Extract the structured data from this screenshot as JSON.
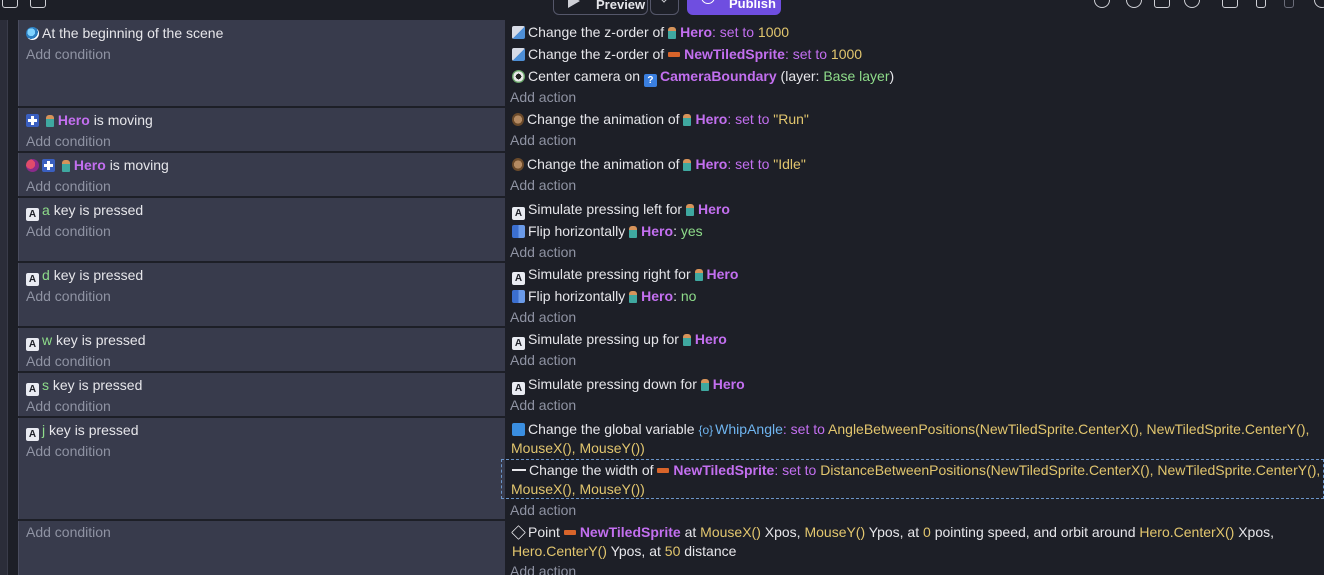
{
  "toolbar": {
    "preview_label": "Preview",
    "publish_label": "Publish"
  },
  "events": [
    {
      "conditions": [
        {
          "icon": "scene-icon",
          "text": "At the beginning of the scene"
        }
      ],
      "add_condition": "Add condition",
      "actions": [
        {
          "icon": "z-order-icon",
          "pre": "Change the z-order of",
          "object": "Hero",
          "op": ": set to",
          "value": "1000"
        },
        {
          "icon": "z-order-icon",
          "pre": "Change the z-order of",
          "object": "NewTiledSprite",
          "op": ": set to",
          "value": "1000"
        },
        {
          "icon": "camera-icon",
          "pre": "Center camera on",
          "object": "CameraBoundary",
          "layer_pre": "(layer:",
          "layer": "Base layer",
          "layer_post": ")"
        }
      ],
      "add_action": "Add action"
    },
    {
      "conditions": [
        {
          "icon": "move-icon",
          "object": "Hero",
          "text": "is moving"
        }
      ],
      "add_condition": "Add condition",
      "actions": [
        {
          "icon": "animation-icon",
          "pre": "Change the animation of",
          "object": "Hero",
          "op": ": set to",
          "value": "\"Run\""
        }
      ],
      "add_action": "Add action"
    },
    {
      "conditions": [
        {
          "icon": "not-icon",
          "object": "Hero",
          "text": "is moving"
        }
      ],
      "add_condition": "Add condition",
      "actions": [
        {
          "icon": "animation-icon",
          "pre": "Change the animation of",
          "object": "Hero",
          "op": ": set to",
          "value": "\"Idle\""
        }
      ],
      "add_action": "Add action"
    },
    {
      "conditions": [
        {
          "icon": "keyboard-icon",
          "key": "a",
          "text": "key is pressed"
        }
      ],
      "add_condition": "Add condition",
      "actions": [
        {
          "icon": "keyboard-icon",
          "pre": "Simulate pressing left for",
          "object": "Hero"
        },
        {
          "icon": "flip-icon",
          "pre": "Flip horizontally",
          "object": "Hero",
          "op": ":",
          "value": "yes"
        }
      ],
      "add_action": "Add action"
    },
    {
      "conditions": [
        {
          "icon": "keyboard-icon",
          "key": "d",
          "text": "key is pressed"
        }
      ],
      "add_condition": "Add condition",
      "actions": [
        {
          "icon": "keyboard-icon",
          "pre": "Simulate pressing right for",
          "object": "Hero"
        },
        {
          "icon": "flip-icon",
          "pre": "Flip horizontally",
          "object": "Hero",
          "op": ":",
          "value": "no"
        }
      ],
      "add_action": "Add action"
    },
    {
      "conditions": [
        {
          "icon": "keyboard-icon",
          "key": "w",
          "text": "key is pressed"
        }
      ],
      "add_condition": "Add condition",
      "actions": [
        {
          "icon": "keyboard-icon",
          "pre": "Simulate pressing up for",
          "object": "Hero"
        }
      ],
      "add_action": "Add action"
    },
    {
      "conditions": [
        {
          "icon": "keyboard-icon",
          "key": "s",
          "text": "key is pressed"
        }
      ],
      "add_condition": "Add condition",
      "actions": [
        {
          "icon": "keyboard-icon",
          "pre": "Simulate pressing down for",
          "object": "Hero"
        }
      ],
      "add_action": "Add action"
    },
    {
      "conditions": [
        {
          "icon": "keyboard-icon",
          "key": "j",
          "text": "key is pressed"
        }
      ],
      "add_condition": "Add condition",
      "actions": [
        {
          "icon": "variable-icon",
          "pre": "Change the global variable",
          "variable": "WhipAngle",
          "op": ": set to",
          "expr_line1": "AngleBetweenPositions(NewTiledSprite.CenterX(), NewTiledSprite.CenterY(),",
          "expr_line2": "MouseX(), MouseY())"
        },
        {
          "icon": "width-icon",
          "pre": "Change the width of",
          "object": "NewTiledSprite",
          "op": ": set to",
          "expr_line1": "DistanceBetweenPositions(NewTiledSprite.CenterX(), NewTiledSprite.CenterY(),",
          "expr_line2": "MouseX(), MouseY())"
        }
      ],
      "add_action": "Add action"
    },
    {
      "conditions": [],
      "add_condition": "Add condition",
      "actions": [
        {
          "icon": "rotate-icon",
          "pre": "Point",
          "object": "NewTiledSprite",
          "t1": "at",
          "e1": "MouseX()",
          "t2": "Xpos,",
          "e2": "MouseY()",
          "t3": "Ypos, at",
          "e3": "0",
          "t4": "pointing speed, and orbit around",
          "e4": "Hero.CenterX()",
          "t5": "Xpos,",
          "e5": "Hero.CenterY()",
          "t6": "Ypos, at",
          "e6": "50",
          "t7": "distance"
        }
      ],
      "add_action": "Add action"
    }
  ]
}
